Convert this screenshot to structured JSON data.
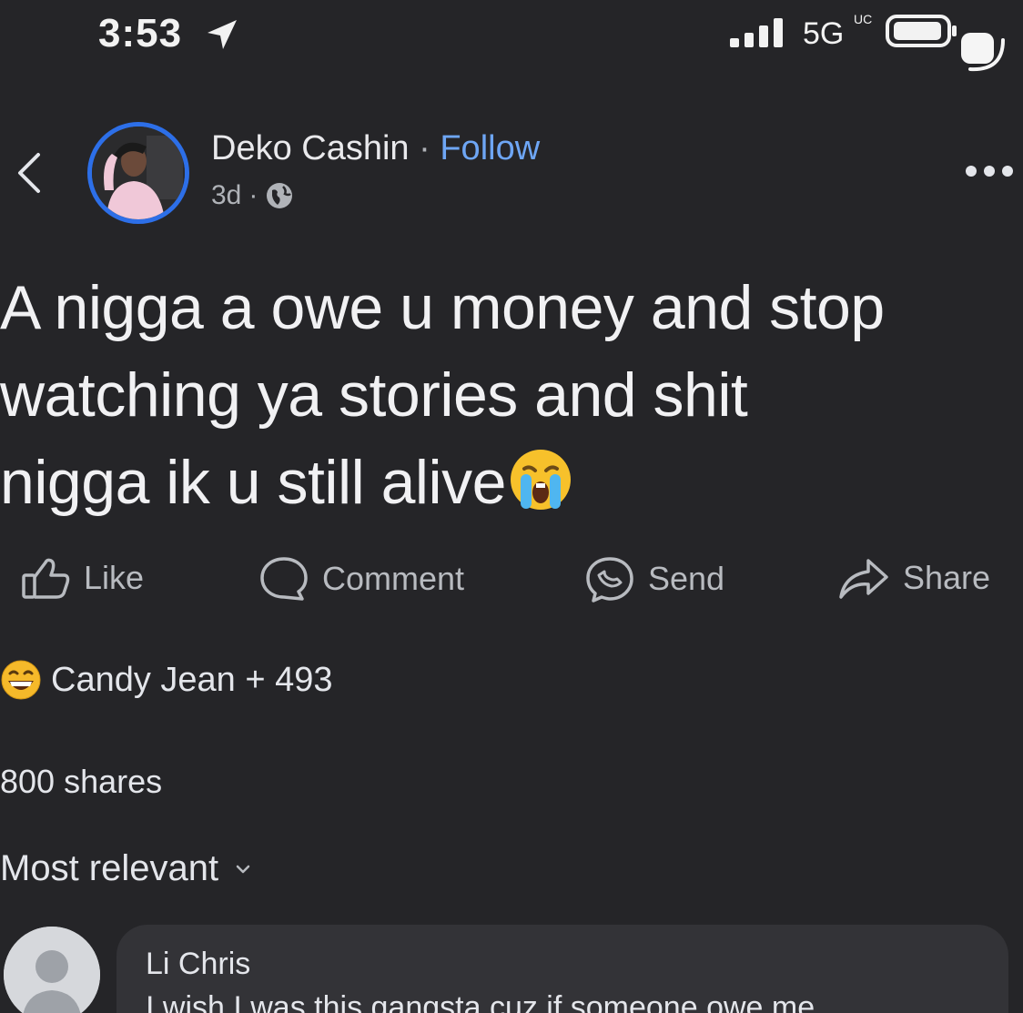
{
  "status_bar": {
    "time": "3:53",
    "network": "5G",
    "network_sub": "UC"
  },
  "post": {
    "author": "Deko Cashin",
    "separator": "·",
    "follow_label": "Follow",
    "age": "3d",
    "meta_separator": "·",
    "text_lines": [
      "A nigga a owe u money and stop",
      "watching ya stories and shit",
      "nigga ik u still alive"
    ]
  },
  "actions": {
    "like": "Like",
    "comment": "Comment",
    "send": "Send",
    "share": "Share"
  },
  "reactions": {
    "summary": "Candy Jean + 493"
  },
  "shares": "800 shares",
  "sort": {
    "label": "Most relevant"
  },
  "comment": {
    "author": "Li Chris",
    "text": "I wish I was this gangsta cuz if someone owe me"
  },
  "icons": {
    "back": "chevron-left-icon",
    "more": "more-horizontal-icon",
    "globe": "globe-icon",
    "like": "thumbs-up-icon",
    "comment": "speech-bubble-icon",
    "send": "messenger-icon",
    "share": "share-arrow-icon",
    "reaction": "grinning-sweat-emoji",
    "post_emoji": "loudly-crying-emoji"
  },
  "colors": {
    "background": "#252528",
    "follow": "#6ea6f5",
    "avatar_ring": "#2d6fe8",
    "bubble": "#333337"
  }
}
